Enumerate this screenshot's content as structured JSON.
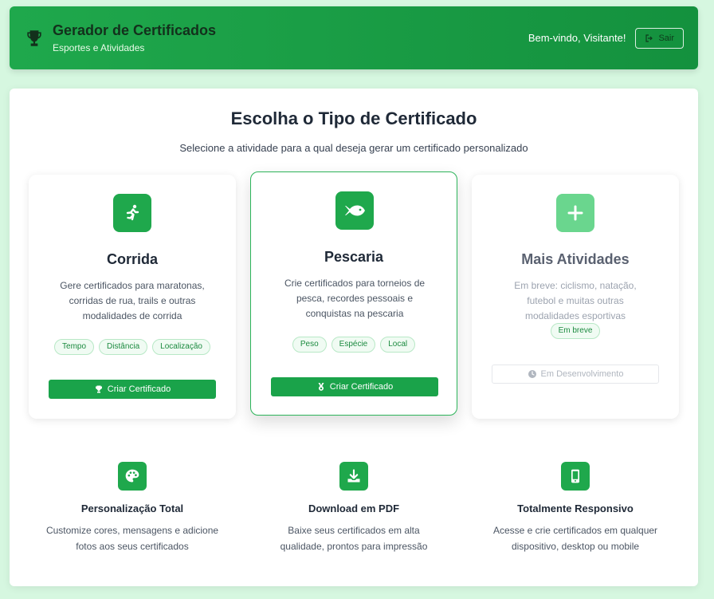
{
  "header": {
    "title": "Gerador de Certificados",
    "subtitle": "Esportes e Atividades",
    "welcome": "Bem-vindo, Visitante!",
    "logout_label": "Sair"
  },
  "main": {
    "title": "Escolha o Tipo de Certificado",
    "subtitle": "Selecione a atividade para a qual deseja gerar um certificado personalizado"
  },
  "cards": [
    {
      "icon": "running-icon",
      "title": "Corrida",
      "description": "Gere certificados para maratonas, corridas de rua, trails e outras modalidades de corrida",
      "tags": [
        "Tempo",
        "Distância",
        "Localização"
      ],
      "button_label": "Criar Certificado",
      "button_icon": "trophy-icon"
    },
    {
      "icon": "fish-icon",
      "title": "Pescaria",
      "description": "Crie certificados para torneios de pesca, recordes pessoais e conquistas na pescaria",
      "tags": [
        "Peso",
        "Espécie",
        "Local"
      ],
      "button_label": "Criar Certificado",
      "button_icon": "medal-icon"
    },
    {
      "icon": "plus-icon",
      "title": "Mais Atividades",
      "description": "Em breve: ciclismo, natação, futebol e muitas outras modalidades esportivas",
      "tags": [
        "Em breve"
      ],
      "button_label": "Em Desenvolvimento",
      "button_icon": "clock-icon"
    }
  ],
  "features": [
    {
      "icon": "palette-icon",
      "title": "Personalização Total",
      "description": "Customize cores, mensagens e adicione fotos aos seus certificados"
    },
    {
      "icon": "download-icon",
      "title": "Download em PDF",
      "description": "Baixe seus certificados em alta qualidade, prontos para impressão"
    },
    {
      "icon": "mobile-icon",
      "title": "Totalmente Responsivo",
      "description": "Acesse e crie certificados em qualquer dispositivo, desktop ou mobile"
    }
  ],
  "colors": {
    "brand": "#1fa84c",
    "background": "#d6f7e0",
    "accent_light": "#6ad68e"
  }
}
